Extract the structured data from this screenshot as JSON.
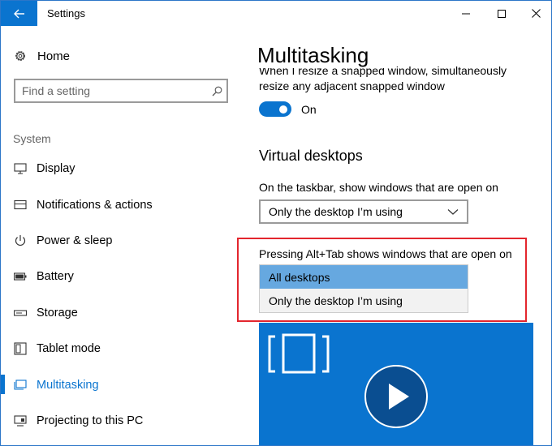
{
  "window": {
    "title": "Settings"
  },
  "sidebar": {
    "home_label": "Home",
    "search_placeholder": "Find a setting",
    "section": "System",
    "items": [
      {
        "label": "Display",
        "icon": "display-icon"
      },
      {
        "label": "Notifications & actions",
        "icon": "notifications-icon"
      },
      {
        "label": "Power & sleep",
        "icon": "power-icon"
      },
      {
        "label": "Battery",
        "icon": "battery-icon"
      },
      {
        "label": "Storage",
        "icon": "storage-icon"
      },
      {
        "label": "Tablet mode",
        "icon": "tablet-mode-icon"
      },
      {
        "label": "Multitasking",
        "icon": "multitasking-icon",
        "active": true
      },
      {
        "label": "Projecting to this PC",
        "icon": "projecting-icon"
      }
    ]
  },
  "content": {
    "title": "Multitasking",
    "snap_text_line1": "When I resize a snapped window, simultaneously",
    "snap_text_line2": "resize any adjacent snapped window",
    "toggle_state": "On",
    "virtual_desktops_heading": "Virtual desktops",
    "taskbar_label": "On the taskbar, show windows that are open on",
    "taskbar_value": "Only the desktop I’m using",
    "alttab_label": "Pressing Alt+Tab shows windows that are open on",
    "alttab_options": [
      "All desktops",
      "Only the desktop I’m using"
    ],
    "alttab_selected": "All desktops"
  },
  "colors": {
    "accent": "#0a74cf",
    "dropdown_selected": "#66a8e0",
    "highlight": "#e3262e"
  }
}
